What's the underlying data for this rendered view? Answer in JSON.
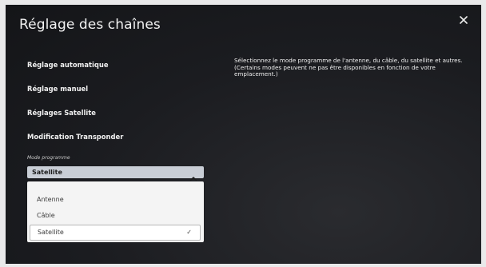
{
  "header": {
    "title": "Réglage des chaînes"
  },
  "menu": {
    "items": [
      {
        "label": "Réglage automatique"
      },
      {
        "label": "Réglage manuel"
      },
      {
        "label": "Réglages Satellite"
      },
      {
        "label": "Modification Transponder"
      }
    ]
  },
  "mode": {
    "label": "Mode programme",
    "selected": "Satellite",
    "options": [
      {
        "label": "Antenne"
      },
      {
        "label": "Câble"
      },
      {
        "label": "Satellite",
        "check": "✓"
      }
    ]
  },
  "description": {
    "text": "Sélectionnez le mode programme de l'antenne, du câble, du satellite et autres. (Certains modes peuvent ne pas être disponibles en fonction de votre emplacement.)"
  },
  "icons": {
    "close": "close-icon",
    "chevron": "chevron-up-icon",
    "check": "checkmark-icon"
  },
  "colors": {
    "background": "#1b1c20",
    "select_bg": "#c9ced6",
    "dropdown_bg": "#f4f4f4"
  }
}
